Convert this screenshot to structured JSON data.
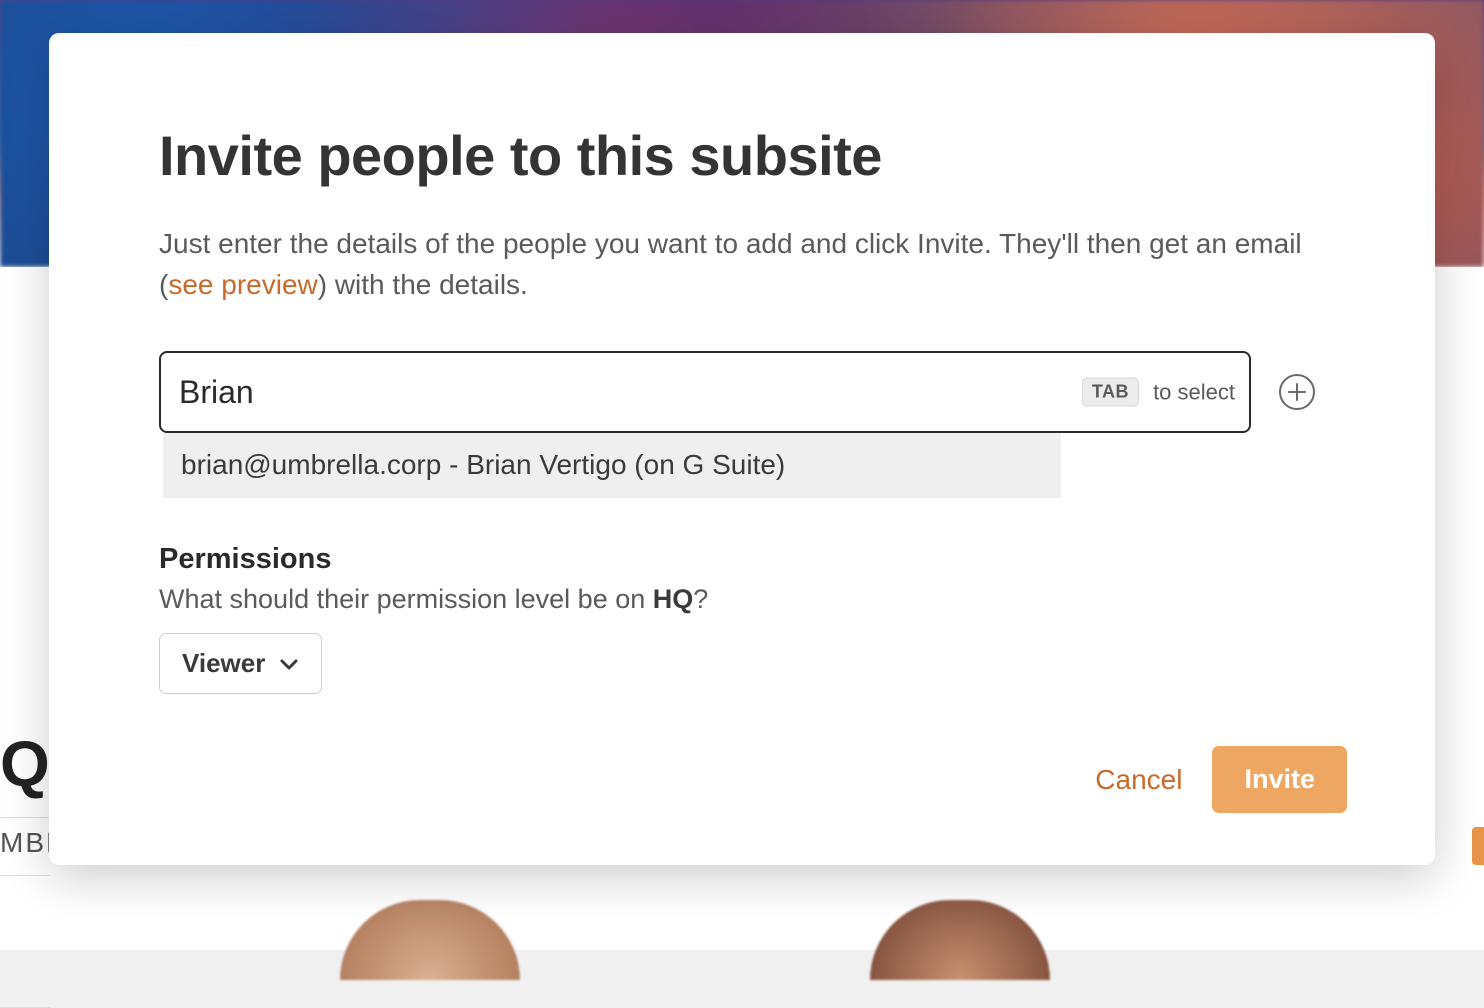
{
  "background": {
    "page_initial": "Q",
    "truncated_text": "MBN"
  },
  "modal": {
    "title": "Invite people to this subsite",
    "desc_part1": "Just enter the details of the people you want to add and click Invite. They'll then get an email (",
    "preview_link": "see preview",
    "desc_part2": ") with the details.",
    "input": {
      "value": "Brian",
      "hint_key": "TAB",
      "hint_text": "to select"
    },
    "suggestion": "brian@umbrella.corp - Brian Vertigo (on G Suite)",
    "permissions": {
      "heading": "Permissions",
      "question_prefix": "What should their permission level be on ",
      "site_name": "HQ",
      "question_suffix": "?",
      "selected_role": "Viewer"
    },
    "footer": {
      "cancel": "Cancel",
      "invite": "Invite"
    }
  }
}
